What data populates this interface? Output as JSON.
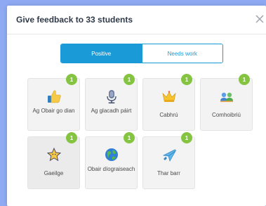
{
  "dialog": {
    "title": "Give feedback to 33 students"
  },
  "tabs": [
    {
      "label": "Positive",
      "active": true
    },
    {
      "label": "Needs work",
      "active": false
    }
  ],
  "skills": [
    {
      "label": "Ag Obair go dian",
      "count": "1",
      "icon": "thumbs-up-icon"
    },
    {
      "label": "Ag glacadh páirt",
      "count": "1",
      "icon": "microphone-icon"
    },
    {
      "label": "Cabhrú",
      "count": "1",
      "icon": "crown-icon"
    },
    {
      "label": "Comhoibriú",
      "count": "1",
      "icon": "people-icon"
    },
    {
      "label": "Gaeilge",
      "count": "1",
      "icon": "star-icon"
    },
    {
      "label": "Obair díograiseach",
      "count": "1",
      "icon": "globe-icon"
    },
    {
      "label": "Thar barr",
      "count": "1",
      "icon": "airplane-icon"
    }
  ],
  "colors": {
    "accent": "#1a9ad6",
    "badge": "#84c441",
    "backdrop": "#8fa9f2"
  }
}
